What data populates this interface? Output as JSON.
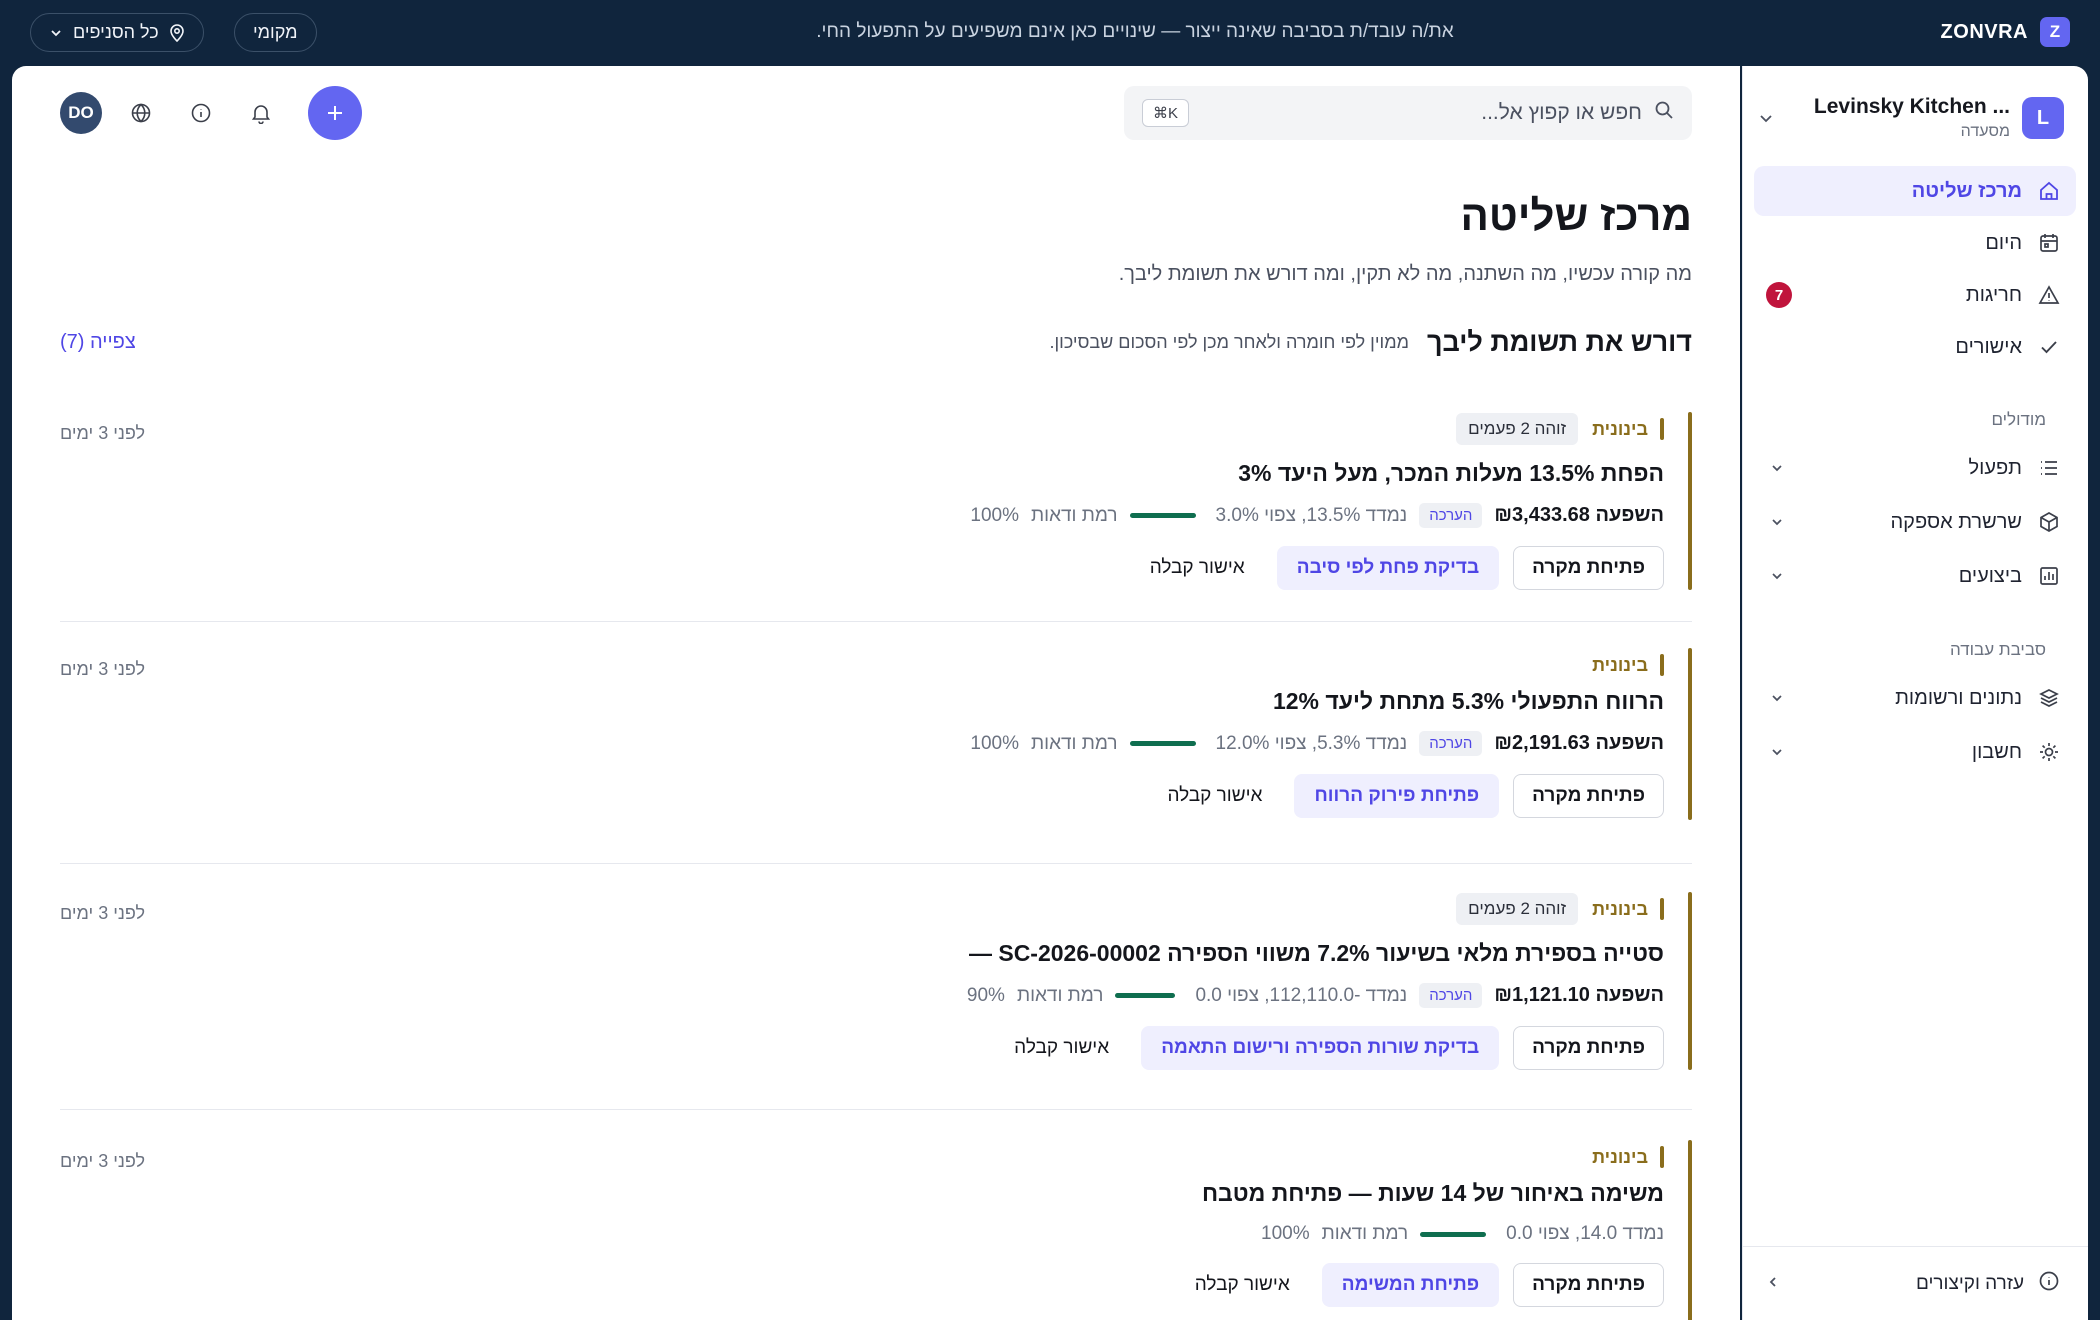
{
  "topbar": {
    "brand_name": "ZONVRA",
    "brand_badge": "Z",
    "env_note": "את/ה עובד/ת בסביבה שאינה ייצור — שינויים כאן אינם משפיעים על התפעול החי.",
    "local_pill": "מקומי",
    "branches_pill": "כל הסניפים"
  },
  "sidebar": {
    "org_initial": "L",
    "org_name": "Levinsky Kitchen ...",
    "org_type": "מסעדה",
    "primary_items": [
      {
        "label": "מרכז שליטה",
        "icon": "home-icon"
      },
      {
        "label": "היום",
        "icon": "calendar-icon"
      },
      {
        "label": "חריגות",
        "icon": "alert-triangle-icon",
        "badge": "7"
      },
      {
        "label": "אישורים",
        "icon": "check-icon"
      }
    ],
    "modules_title": "מודולים",
    "modules": [
      {
        "label": "תפעול",
        "icon": "list-icon"
      },
      {
        "label": "שרשרת אספקה",
        "icon": "box-icon"
      },
      {
        "label": "ביצועים",
        "icon": "bar-chart-icon"
      }
    ],
    "workspace_title": "סביבת עבודה",
    "workspace": [
      {
        "label": "נתונים ורשומות",
        "icon": "layers-icon"
      },
      {
        "label": "חשבון",
        "icon": "gear-icon"
      }
    ],
    "footer_label": "עזרה וקיצורים"
  },
  "header": {
    "search_placeholder": "חפש או קפוץ אל...",
    "search_kbd": "⌘K",
    "avatar": "DO"
  },
  "page": {
    "title": "מרכז שליטה",
    "subtitle": "מה קורה עכשיו, מה השתנה, מה לא תקין, ומה דורש את תשומת ליבך.",
    "section_title": "דורש את תשומת ליבך",
    "section_desc": "ממוין לפי חומרה ולאחר מכן לפי הסכום שבסיכון.",
    "view_link": "צפייה (7)"
  },
  "colors": {
    "accent": "#6366f1",
    "severity_medium": "#8a6d1c",
    "confidence": "#0f6e4f",
    "badge_red": "#c0143c"
  },
  "cards": [
    {
      "severity": "בינונית",
      "seen": "זוהה 2 פעמים",
      "time": "לפני 3 ימים",
      "title": "הפחת 13.5% מעלות המכר, מעל היעד 3%",
      "impact": "השפעה ₪3,433.68",
      "estimate": "הערכה",
      "measured": "נמדד 13.5%, צפוי 3.0%",
      "confidence_label": "רמת ודאות",
      "confidence": "100%",
      "confidence_value": 1.0,
      "btn_primary": "פתיחת מקרה",
      "btn_secondary": "בדיקת פחת לפי סיבה",
      "btn_tertiary": "אישור קבלה"
    },
    {
      "severity": "בינונית",
      "seen": "",
      "time": "לפני 3 ימים",
      "title": "הרווח התפעולי 5.3% מתחת ליעד 12%",
      "impact": "השפעה ₪2,191.63",
      "estimate": "הערכה",
      "measured": "נמדד 5.3%, צפוי 12.0%",
      "confidence_label": "רמת ודאות",
      "confidence": "100%",
      "confidence_value": 1.0,
      "btn_primary": "פתיחת מקרה",
      "btn_secondary": "פתיחת פירוק הרווח",
      "btn_tertiary": "אישור קבלה"
    },
    {
      "severity": "בינונית",
      "seen": "זוהה 2 פעמים",
      "time": "לפני 3 ימים",
      "title": "סטייה בספירת מלאי בשיעור 7.2% משווי הספירה SC-2026-00002 —",
      "impact": "השפעה ₪1,121.10",
      "estimate": "הערכה",
      "measured": "נמדד -112,110.0, צפוי 0.0",
      "confidence_label": "רמת ודאות",
      "confidence": "90%",
      "confidence_value": 0.9,
      "btn_primary": "פתיחת מקרה",
      "btn_secondary": "בדיקת שורות הספירה ורישום התאמה",
      "btn_tertiary": "אישור קבלה"
    },
    {
      "severity": "בינונית",
      "seen": "",
      "time": "לפני 3 ימים",
      "title": "משימה באיחור של 14 שעות — פתיחת מטבח",
      "impact": "",
      "estimate": "",
      "measured": "נמדד 14.0, צפוי 0.0",
      "confidence_label": "רמת ודאות",
      "confidence": "100%",
      "confidence_value": 1.0,
      "btn_primary": "פתיחת מקרה",
      "btn_secondary": "פתיחת המשימה",
      "btn_tertiary": "אישור קבלה"
    }
  ]
}
